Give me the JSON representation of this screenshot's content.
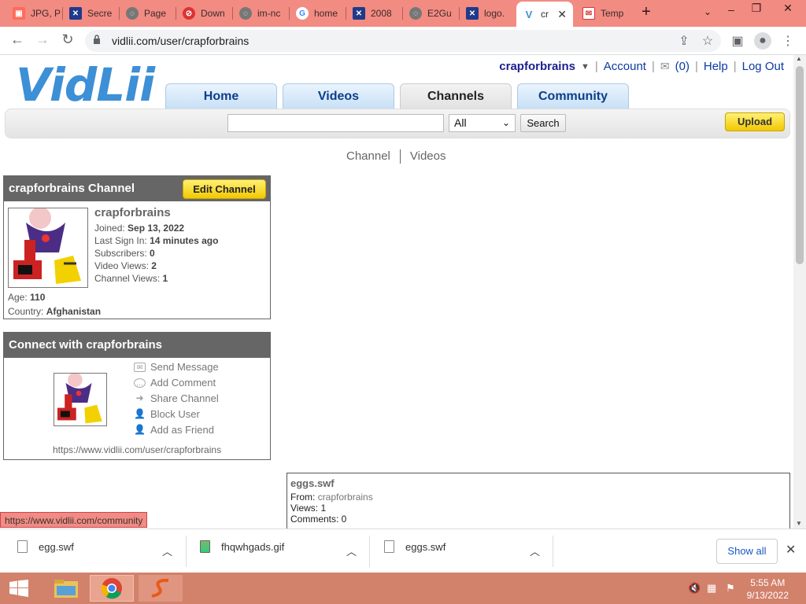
{
  "browser": {
    "tabs": [
      {
        "label": "JPG, P",
        "icon": "image-icon",
        "color": "#ff6b5b"
      },
      {
        "label": "Secre",
        "icon": "flag-icon",
        "color": "#1e3a8a"
      },
      {
        "label": "Page",
        "icon": "globe-icon",
        "color": "#666"
      },
      {
        "label": "Down",
        "icon": "ban-icon",
        "color": "#d33"
      },
      {
        "label": "im-nc",
        "icon": "globe-icon",
        "color": "#666"
      },
      {
        "label": "home",
        "icon": "google-icon",
        "color": "#4285f4"
      },
      {
        "label": "2008",
        "icon": "flag-icon",
        "color": "#1e3a8a"
      },
      {
        "label": "E2Gu",
        "icon": "globe-icon",
        "color": "#666"
      },
      {
        "label": "logo.",
        "icon": "flag-icon",
        "color": "#1e3a8a"
      },
      {
        "label": "cr",
        "icon": "vidlii-icon",
        "color": "#3d8fd6"
      },
      {
        "label": "Temp",
        "icon": "mail-icon",
        "color": "#d33"
      }
    ],
    "url": "vidlii.com/user/crapforbrains"
  },
  "site": {
    "logo": "VidLii",
    "user": {
      "name": "crapforbrains",
      "account": "Account",
      "inbox": "(0)",
      "help": "Help",
      "logout": "Log Out"
    },
    "nav": {
      "home": "Home",
      "videos": "Videos",
      "channels": "Channels",
      "community": "Community"
    },
    "search": {
      "category": "All",
      "button": "Search",
      "upload": "Upload"
    },
    "subnav": {
      "channel": "Channel",
      "videos": "Videos"
    }
  },
  "channel": {
    "title": "crapforbrains Channel",
    "edit": "Edit Channel",
    "username": "crapforbrains",
    "joined_label": "Joined:",
    "joined": "Sep 13, 2022",
    "last_label": "Last Sign In:",
    "last": "14 minutes ago",
    "subs_label": "Subscribers:",
    "subs": "0",
    "views_label": "Video Views:",
    "views": "2",
    "chviews_label": "Channel Views:",
    "chviews": "1",
    "age_label": "Age:",
    "age": "110",
    "country_label": "Country:",
    "country": "Afghanistan"
  },
  "connect": {
    "title": "Connect with crapforbrains",
    "send": "Send Message",
    "comment": "Add Comment",
    "share": "Share Channel",
    "block": "Block User",
    "friend": "Add as Friend",
    "url": "https://www.vidlii.com/user/crapforbrains"
  },
  "video": {
    "title": "eggs.swf",
    "from_label": "From:",
    "from": "crapforbrains",
    "views": "Views: 1",
    "comments": "Comments: 0"
  },
  "status_link": "https://www.vidlii.com/community",
  "downloads": {
    "items": [
      "egg.swf",
      "fhqwhgads.gif",
      "eggs.swf"
    ],
    "show_all": "Show all"
  },
  "taskbar": {
    "time": "5:55 AM",
    "date": "9/13/2022"
  }
}
